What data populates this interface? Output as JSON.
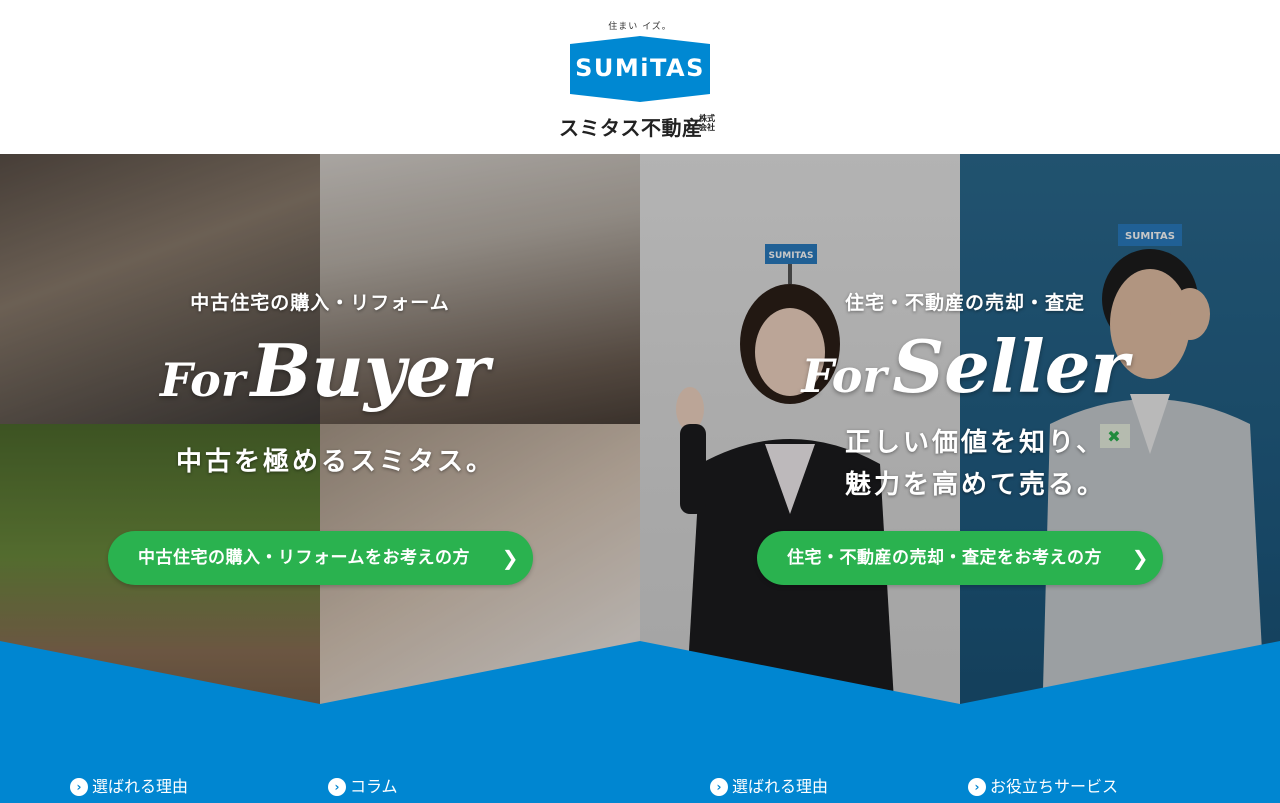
{
  "header": {
    "tagline": "住まい イズ。",
    "logo_text": "SUMiTAS",
    "company_name": "スミタス不動産",
    "company_suffix": "株式会社",
    "brand_color": "#0088d2"
  },
  "buyer": {
    "subtitle": "中古住宅の購入・リフォーム",
    "title_small": "For",
    "title_big": "Buyer",
    "copy": "中古を極めるスミタス。",
    "cta_label": "中古住宅の購入・リフォームをお考えの方",
    "cta_color": "#2ab24f"
  },
  "seller": {
    "subtitle": "住宅・不動産の売却・査定",
    "title_small": "For",
    "title_big": "Seller",
    "copy_line1": "正しい価値を知り、",
    "copy_line2": "魅力を高めて売る。",
    "cta_label": "住宅・不動産の売却・査定をお考えの方",
    "cap_text": "SUMITAS",
    "cap_text_2": "SUMITAS"
  },
  "bottom_nav": {
    "items": [
      {
        "label": "選ばれる理由",
        "icon": "chevron-right-circle-icon"
      },
      {
        "label": "コラム",
        "icon": "chevron-right-circle-icon"
      },
      {
        "label": "選ばれる理由",
        "icon": "chevron-right-circle-icon"
      },
      {
        "label": "お役立ちサービス",
        "icon": "chevron-right-circle-icon"
      }
    ],
    "band_color": "#0086d1"
  }
}
